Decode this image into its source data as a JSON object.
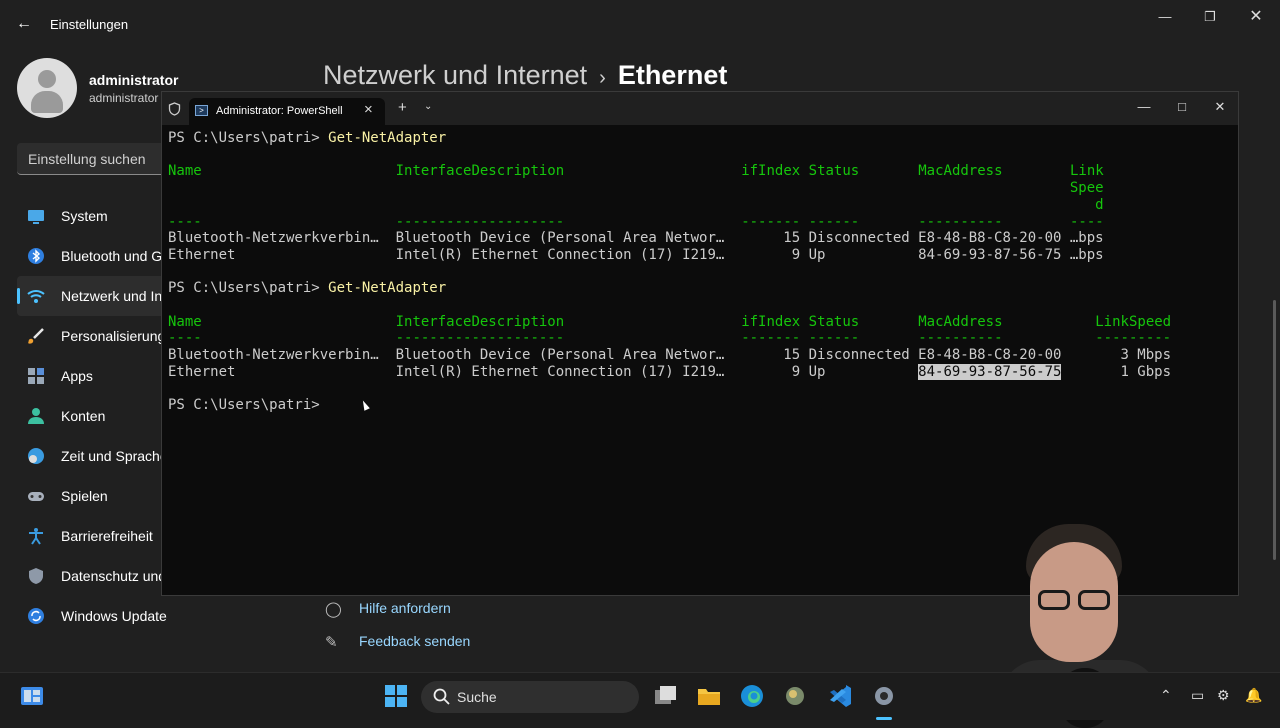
{
  "settings": {
    "app_title": "Einstellungen",
    "user": {
      "name": "administrator",
      "sub": "administrator"
    },
    "search_placeholder": "Einstellung suchen",
    "nav": [
      {
        "label": "System",
        "icon": "monitor-icon"
      },
      {
        "label": "Bluetooth und G",
        "icon": "bluetooth-icon"
      },
      {
        "label": "Netzwerk und In",
        "icon": "wifi-icon",
        "active": true
      },
      {
        "label": "Personalisierung",
        "icon": "brush-icon"
      },
      {
        "label": "Apps",
        "icon": "apps-icon"
      },
      {
        "label": "Konten",
        "icon": "account-icon"
      },
      {
        "label": "Zeit und Sprache",
        "icon": "clock-globe-icon"
      },
      {
        "label": "Spielen",
        "icon": "gamepad-icon"
      },
      {
        "label": "Barrierefreiheit",
        "icon": "accessibility-icon"
      },
      {
        "label": "Datenschutz und",
        "icon": "shield-icon"
      },
      {
        "label": "Windows Update",
        "icon": "update-icon"
      }
    ],
    "breadcrumb": {
      "parent": "Netzwerk und Internet",
      "sep": "›",
      "current": "Ethernet"
    },
    "help_links": [
      {
        "label": "Hilfe anfordern",
        "icon": "help-icon"
      },
      {
        "label": "Feedback senden",
        "icon": "feedback-icon"
      }
    ]
  },
  "terminal": {
    "tab_title": "Administrator: PowerShell",
    "prompt": "PS C:\\Users\\patri> ",
    "command": "Get-NetAdapter",
    "table1": {
      "headers": [
        "Name",
        "InterfaceDescription",
        "ifIndex",
        "Status",
        "MacAddress",
        "Link"
      ],
      "header_wrap": [
        "Spee",
        "d"
      ],
      "rows": [
        [
          "Bluetooth-Netzwerkverbin…",
          "Bluetooth Device (Personal Area Networ…",
          "15",
          "Disconnected",
          "E8-48-B8-C8-20-00",
          "…bps"
        ],
        [
          "Ethernet",
          "Intel(R) Ethernet Connection (17) I219…",
          "9",
          "Up",
          "84-69-93-87-56-75",
          "…bps"
        ]
      ]
    },
    "table2": {
      "headers": [
        "Name",
        "InterfaceDescription",
        "ifIndex",
        "Status",
        "MacAddress",
        "LinkSpeed"
      ],
      "rows": [
        [
          "Bluetooth-Netzwerkverbin…",
          "Bluetooth Device (Personal Area Networ…",
          "15",
          "Disconnected",
          "E8-48-B8-C8-20-00",
          "3 Mbps"
        ],
        [
          "Ethernet",
          "Intel(R) Ethernet Connection (17) I219…",
          "9",
          "Up",
          "84-69-93-87-56-75",
          "1 Gbps"
        ]
      ],
      "selected_text": "84-69-93-87-56-75"
    }
  },
  "taskbar": {
    "search_label": "Suche",
    "apps": [
      "start-icon",
      "task-view-icon",
      "file-explorer-icon",
      "edge-icon",
      "app-icon",
      "vscode-icon",
      "settings-icon"
    ]
  },
  "colors": {
    "accent": "#4cc2ff",
    "console_green": "#16c60c",
    "console_cmd": "#f9f1a5"
  }
}
